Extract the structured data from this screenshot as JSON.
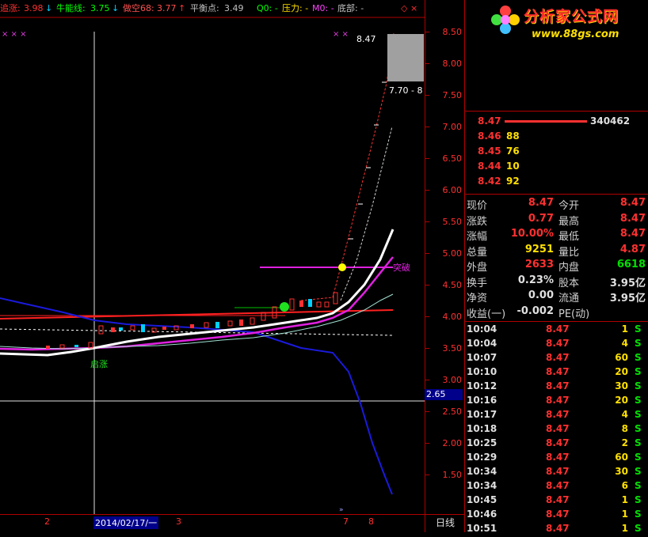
{
  "indicators": {
    "zhuizhang_label": "追涨:",
    "zhuizhang_value": "3.98",
    "niuneng_label": "牛能线:",
    "niuneng_value": "3.75",
    "zuokong_label": "做空68:",
    "zuokong_value": "3.77",
    "pingheng_label": "平衡点:",
    "pingheng_value": "3.49",
    "q0_label": "Q0: -",
    "yali_label": "压力: -",
    "m0_label": "M0: -",
    "dibu_label": "底部: -",
    "corner_glyph": "◇ ×"
  },
  "annotations": {
    "breakout": "突破",
    "high_label": "8.47",
    "range_label": "7.70 - 8",
    "start_marker": "启涨"
  },
  "y_axis": [
    "8.50",
    "8.00",
    "7.50",
    "7.00",
    "6.50",
    "6.00",
    "5.50",
    "5.00",
    "4.50",
    "4.00",
    "3.50",
    "3.00",
    "2.50",
    "2.00",
    "1.50"
  ],
  "crosshair_price": "2.65",
  "x_axis": {
    "labels": [
      {
        "text": "2",
        "key": "m2"
      },
      {
        "text": "2014/02/17/一",
        "key": "date"
      },
      {
        "text": "3",
        "key": "m3"
      },
      {
        "text": "7",
        "key": "m7"
      },
      {
        "text": "8",
        "key": "m8"
      }
    ],
    "period": "日线"
  },
  "logo": {
    "title": "分析家公式网",
    "url": "www.88gs.com"
  },
  "order_book": [
    {
      "price": "8.47",
      "volume": "340462"
    },
    {
      "price": "8.46",
      "volume": "88"
    },
    {
      "price": "8.45",
      "volume": "76"
    },
    {
      "price": "8.44",
      "volume": "10"
    },
    {
      "price": "8.42",
      "volume": "92"
    }
  ],
  "quote": [
    {
      "l": "现价",
      "lv": "8.47",
      "lc": "#ff3030",
      "r": "今开",
      "rv": "8.47",
      "rc": "#ff3030"
    },
    {
      "l": "涨跌",
      "lv": "0.77",
      "lc": "#ff3030",
      "r": "最高",
      "rv": "8.47",
      "rc": "#ff3030"
    },
    {
      "l": "涨幅",
      "lv": "10.00%",
      "lc": "#ff3030",
      "r": "最低",
      "rv": "8.47",
      "rc": "#ff3030"
    },
    {
      "l": "总量",
      "lv": "9251",
      "lc": "#ffe000",
      "r": "量比",
      "rv": "4.87",
      "rc": "#ff3030"
    },
    {
      "l": "外盘",
      "lv": "2633",
      "lc": "#ff3030",
      "r": "内盘",
      "rv": "6618",
      "rc": "#00e000"
    },
    {
      "l": "换手",
      "lv": "0.23%",
      "lc": "#e0e0e0",
      "r": "股本",
      "rv": "3.95亿",
      "rc": "#e0e0e0"
    },
    {
      "l": "净资",
      "lv": "0.00",
      "lc": "#e0e0e0",
      "r": "流通",
      "rv": "3.95亿",
      "rc": "#e0e0e0"
    },
    {
      "l": "收益(一)",
      "lv": "-0.002",
      "lc": "#e0e0e0",
      "r": "PE(动)",
      "rv": "",
      "rc": "#e0e0e0"
    }
  ],
  "ticks": [
    {
      "time": "10:04",
      "price": "8.47",
      "vol": "1",
      "side": "S"
    },
    {
      "time": "10:04",
      "price": "8.47",
      "vol": "4",
      "side": "S"
    },
    {
      "time": "10:07",
      "price": "8.47",
      "vol": "60",
      "side": "S"
    },
    {
      "time": "10:10",
      "price": "8.47",
      "vol": "20",
      "side": "S"
    },
    {
      "time": "10:12",
      "price": "8.47",
      "vol": "30",
      "side": "S"
    },
    {
      "time": "10:16",
      "price": "8.47",
      "vol": "20",
      "side": "S"
    },
    {
      "time": "10:17",
      "price": "8.47",
      "vol": "4",
      "side": "S"
    },
    {
      "time": "10:18",
      "price": "8.47",
      "vol": "8",
      "side": "S"
    },
    {
      "time": "10:25",
      "price": "8.47",
      "vol": "2",
      "side": "S"
    },
    {
      "time": "10:29",
      "price": "8.47",
      "vol": "60",
      "side": "S"
    },
    {
      "time": "10:34",
      "price": "8.47",
      "vol": "30",
      "side": "S"
    },
    {
      "time": "10:34",
      "price": "8.47",
      "vol": "6",
      "side": "S"
    },
    {
      "time": "10:45",
      "price": "8.47",
      "vol": "1",
      "side": "S"
    },
    {
      "time": "10:46",
      "price": "8.47",
      "vol": "1",
      "side": "S"
    },
    {
      "time": "10:51",
      "price": "8.47",
      "vol": "1",
      "side": "S"
    }
  ],
  "colors": {
    "up": "#ff3030",
    "down": "#00e000",
    "accent_yellow": "#ffe000",
    "ma_blue": "#1a1adc",
    "ma_magenta": "#e020e0"
  }
}
